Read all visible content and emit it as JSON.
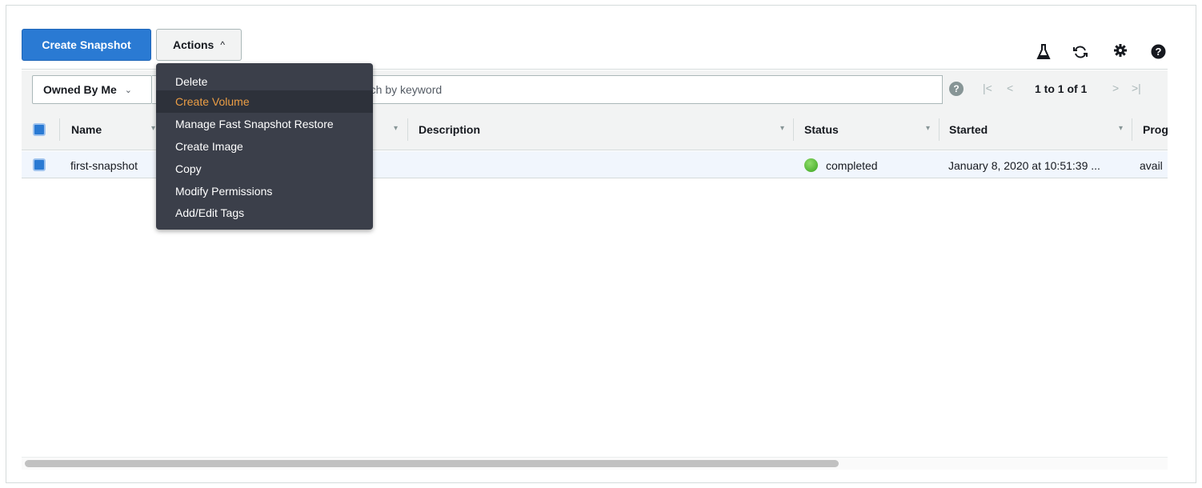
{
  "toolbar": {
    "create_label": "Create Snapshot",
    "actions_label": "Actions",
    "actions_chevron": "^",
    "icons": [
      "flask-icon",
      "refresh-icon",
      "gear-icon",
      "help-icon"
    ]
  },
  "actions_menu": {
    "items": [
      {
        "label": "Delete"
      },
      {
        "label": "Create Volume"
      },
      {
        "label": "Manage Fast Snapshot Restore"
      },
      {
        "label": "Create Image"
      },
      {
        "label": "Copy"
      },
      {
        "label": "Modify Permissions"
      },
      {
        "label": "Add/Edit Tags"
      }
    ],
    "highlighted": "Create Volume"
  },
  "filter": {
    "owner_select": "Owned By Me",
    "search_placeholder": "rch by keyword",
    "help_glyph": "?",
    "pagination": "1 to 1 of 1"
  },
  "table": {
    "columns": [
      "Name",
      "Description",
      "Status",
      "Started",
      "Prog"
    ],
    "rows": [
      {
        "name": "first-snapshot",
        "description": "",
        "status": "completed",
        "started": "January 8, 2020 at 10:51:39 ...",
        "progress": "avail"
      }
    ]
  },
  "colors": {
    "primary": "#2a7ad3",
    "menu_bg": "#3b3f4a",
    "menu_highlight_text": "#ec9e45",
    "status_ok": "#3aa41f"
  }
}
